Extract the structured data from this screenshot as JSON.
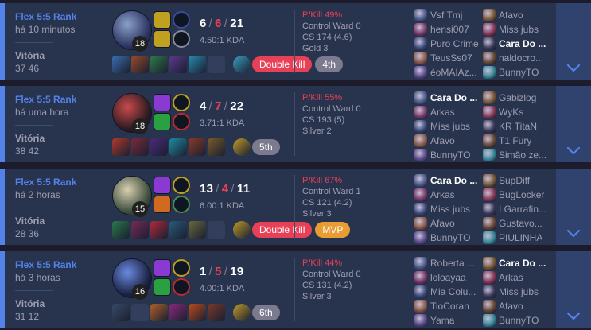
{
  "colors": {
    "win_border": "#5383e8",
    "card_bg": "#28344e",
    "expand_bg": "#2f436e",
    "loss_red": "#e84057"
  },
  "matches": [
    {
      "queue": "Flex 5:5 Rank",
      "time": "há 10 minutos",
      "result": "Vitória",
      "duration": "37 46",
      "champion_level": "18",
      "kills": "6",
      "deaths": "6",
      "assists": "21",
      "kda_ratio": "4.50:1 KDA",
      "badges": [
        {
          "label": "Double Kill",
          "kind": "multikill"
        },
        {
          "label": "4th",
          "kind": "place"
        }
      ],
      "p_kill": "P/Kill 49%",
      "control_ward": "Control Ward 0",
      "cs": "CS 174 (4.6)",
      "rank": "Gold 3",
      "team1": [
        "Vsf Tmj",
        "hensi007",
        "Puro Crime",
        "TeusSs07",
        "éoMAIAz..."
      ],
      "team2": [
        "Afavo",
        "Miss jubs",
        "Cara Do ...",
        "naldocro...",
        "BunnyTO"
      ],
      "me": "Cara Do ..."
    },
    {
      "queue": "Flex 5:5 Rank",
      "time": "há uma hora",
      "result": "Vitória",
      "duration": "38 42",
      "champion_level": "18",
      "kills": "4",
      "deaths": "7",
      "assists": "22",
      "kda_ratio": "3.71:1 KDA",
      "badges": [
        {
          "label": "5th",
          "kind": "place"
        }
      ],
      "p_kill": "P/Kill 55%",
      "control_ward": "Control Ward 0",
      "cs": "CS 193 (5)",
      "rank": "Silver 2",
      "team1": [
        "Cara Do ...",
        "Arkas",
        "Miss jubs",
        "Afavo",
        "BunnyTO"
      ],
      "team2": [
        "Gabizlog",
        "WyKs",
        "KR TitaN",
        "T1 Fury",
        "Simão ze..."
      ],
      "me": "Cara Do ..."
    },
    {
      "queue": "Flex 5:5 Rank",
      "time": "há 2 horas",
      "result": "Vitória",
      "duration": "28 36",
      "champion_level": "15",
      "kills": "13",
      "deaths": "4",
      "assists": "11",
      "kda_ratio": "6.00:1 KDA",
      "badges": [
        {
          "label": "Double Kill",
          "kind": "multikill"
        },
        {
          "label": "MVP",
          "kind": "mvp"
        }
      ],
      "p_kill": "P/Kill 67%",
      "control_ward": "Control Ward 1",
      "cs": "CS 121 (4.2)",
      "rank": "Silver 3",
      "team1": [
        "Cara Do ...",
        "Arkas",
        "Miss jubs",
        "Afavo",
        "BunnyTO"
      ],
      "team2": [
        "SupDiff",
        "BugLocker",
        "I Garrafin...",
        "Gustavo...",
        "PIULINHA"
      ],
      "me": "Cara Do ..."
    },
    {
      "queue": "Flex 5:5 Rank",
      "time": "há 3 horas",
      "result": "Vitória",
      "duration": "31 12",
      "champion_level": "16",
      "kills": "1",
      "deaths": "5",
      "assists": "19",
      "kda_ratio": "4.00:1 KDA",
      "badges": [
        {
          "label": "6th",
          "kind": "place"
        }
      ],
      "p_kill": "P/Kill 44%",
      "control_ward": "Control Ward 0",
      "cs": "CS 131 (4.2)",
      "rank": "Silver 3",
      "team1": [
        "Roberta ...",
        "loloayaa",
        "Mia Colu...",
        "TioCoran",
        "Yama"
      ],
      "team2": [
        "Cara Do ...",
        "Arkas",
        "Miss jubs",
        "Afavo",
        "BunnyTO"
      ],
      "me": "Cara Do ..."
    }
  ],
  "icons": {
    "expand": "chevron-down-icon",
    "spell": "summoner-spell-icon",
    "rune": "rune-icon",
    "item": "item-icon",
    "ward": "ward-trinket-icon",
    "champion": "champion-portrait-icon"
  }
}
